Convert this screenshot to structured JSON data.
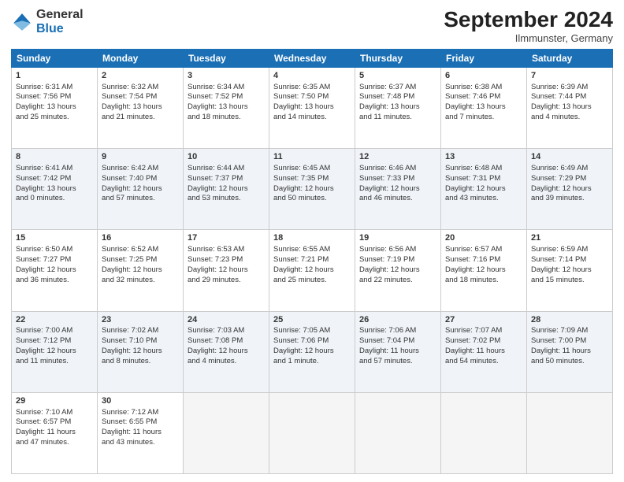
{
  "header": {
    "logo_general": "General",
    "logo_blue": "Blue",
    "month_title": "September 2024",
    "location": "Ilmmunster, Germany"
  },
  "days_of_week": [
    "Sunday",
    "Monday",
    "Tuesday",
    "Wednesday",
    "Thursday",
    "Friday",
    "Saturday"
  ],
  "weeks": [
    [
      {
        "day": 1,
        "lines": [
          "Sunrise: 6:31 AM",
          "Sunset: 7:56 PM",
          "Daylight: 13 hours",
          "and 25 minutes."
        ]
      },
      {
        "day": 2,
        "lines": [
          "Sunrise: 6:32 AM",
          "Sunset: 7:54 PM",
          "Daylight: 13 hours",
          "and 21 minutes."
        ]
      },
      {
        "day": 3,
        "lines": [
          "Sunrise: 6:34 AM",
          "Sunset: 7:52 PM",
          "Daylight: 13 hours",
          "and 18 minutes."
        ]
      },
      {
        "day": 4,
        "lines": [
          "Sunrise: 6:35 AM",
          "Sunset: 7:50 PM",
          "Daylight: 13 hours",
          "and 14 minutes."
        ]
      },
      {
        "day": 5,
        "lines": [
          "Sunrise: 6:37 AM",
          "Sunset: 7:48 PM",
          "Daylight: 13 hours",
          "and 11 minutes."
        ]
      },
      {
        "day": 6,
        "lines": [
          "Sunrise: 6:38 AM",
          "Sunset: 7:46 PM",
          "Daylight: 13 hours",
          "and 7 minutes."
        ]
      },
      {
        "day": 7,
        "lines": [
          "Sunrise: 6:39 AM",
          "Sunset: 7:44 PM",
          "Daylight: 13 hours",
          "and 4 minutes."
        ]
      }
    ],
    [
      {
        "day": 8,
        "lines": [
          "Sunrise: 6:41 AM",
          "Sunset: 7:42 PM",
          "Daylight: 13 hours",
          "and 0 minutes."
        ]
      },
      {
        "day": 9,
        "lines": [
          "Sunrise: 6:42 AM",
          "Sunset: 7:40 PM",
          "Daylight: 12 hours",
          "and 57 minutes."
        ]
      },
      {
        "day": 10,
        "lines": [
          "Sunrise: 6:44 AM",
          "Sunset: 7:37 PM",
          "Daylight: 12 hours",
          "and 53 minutes."
        ]
      },
      {
        "day": 11,
        "lines": [
          "Sunrise: 6:45 AM",
          "Sunset: 7:35 PM",
          "Daylight: 12 hours",
          "and 50 minutes."
        ]
      },
      {
        "day": 12,
        "lines": [
          "Sunrise: 6:46 AM",
          "Sunset: 7:33 PM",
          "Daylight: 12 hours",
          "and 46 minutes."
        ]
      },
      {
        "day": 13,
        "lines": [
          "Sunrise: 6:48 AM",
          "Sunset: 7:31 PM",
          "Daylight: 12 hours",
          "and 43 minutes."
        ]
      },
      {
        "day": 14,
        "lines": [
          "Sunrise: 6:49 AM",
          "Sunset: 7:29 PM",
          "Daylight: 12 hours",
          "and 39 minutes."
        ]
      }
    ],
    [
      {
        "day": 15,
        "lines": [
          "Sunrise: 6:50 AM",
          "Sunset: 7:27 PM",
          "Daylight: 12 hours",
          "and 36 minutes."
        ]
      },
      {
        "day": 16,
        "lines": [
          "Sunrise: 6:52 AM",
          "Sunset: 7:25 PM",
          "Daylight: 12 hours",
          "and 32 minutes."
        ]
      },
      {
        "day": 17,
        "lines": [
          "Sunrise: 6:53 AM",
          "Sunset: 7:23 PM",
          "Daylight: 12 hours",
          "and 29 minutes."
        ]
      },
      {
        "day": 18,
        "lines": [
          "Sunrise: 6:55 AM",
          "Sunset: 7:21 PM",
          "Daylight: 12 hours",
          "and 25 minutes."
        ]
      },
      {
        "day": 19,
        "lines": [
          "Sunrise: 6:56 AM",
          "Sunset: 7:19 PM",
          "Daylight: 12 hours",
          "and 22 minutes."
        ]
      },
      {
        "day": 20,
        "lines": [
          "Sunrise: 6:57 AM",
          "Sunset: 7:16 PM",
          "Daylight: 12 hours",
          "and 18 minutes."
        ]
      },
      {
        "day": 21,
        "lines": [
          "Sunrise: 6:59 AM",
          "Sunset: 7:14 PM",
          "Daylight: 12 hours",
          "and 15 minutes."
        ]
      }
    ],
    [
      {
        "day": 22,
        "lines": [
          "Sunrise: 7:00 AM",
          "Sunset: 7:12 PM",
          "Daylight: 12 hours",
          "and 11 minutes."
        ]
      },
      {
        "day": 23,
        "lines": [
          "Sunrise: 7:02 AM",
          "Sunset: 7:10 PM",
          "Daylight: 12 hours",
          "and 8 minutes."
        ]
      },
      {
        "day": 24,
        "lines": [
          "Sunrise: 7:03 AM",
          "Sunset: 7:08 PM",
          "Daylight: 12 hours",
          "and 4 minutes."
        ]
      },
      {
        "day": 25,
        "lines": [
          "Sunrise: 7:05 AM",
          "Sunset: 7:06 PM",
          "Daylight: 12 hours",
          "and 1 minute."
        ]
      },
      {
        "day": 26,
        "lines": [
          "Sunrise: 7:06 AM",
          "Sunset: 7:04 PM",
          "Daylight: 11 hours",
          "and 57 minutes."
        ]
      },
      {
        "day": 27,
        "lines": [
          "Sunrise: 7:07 AM",
          "Sunset: 7:02 PM",
          "Daylight: 11 hours",
          "and 54 minutes."
        ]
      },
      {
        "day": 28,
        "lines": [
          "Sunrise: 7:09 AM",
          "Sunset: 7:00 PM",
          "Daylight: 11 hours",
          "and 50 minutes."
        ]
      }
    ],
    [
      {
        "day": 29,
        "lines": [
          "Sunrise: 7:10 AM",
          "Sunset: 6:57 PM",
          "Daylight: 11 hours",
          "and 47 minutes."
        ]
      },
      {
        "day": 30,
        "lines": [
          "Sunrise: 7:12 AM",
          "Sunset: 6:55 PM",
          "Daylight: 11 hours",
          "and 43 minutes."
        ]
      },
      null,
      null,
      null,
      null,
      null
    ]
  ]
}
